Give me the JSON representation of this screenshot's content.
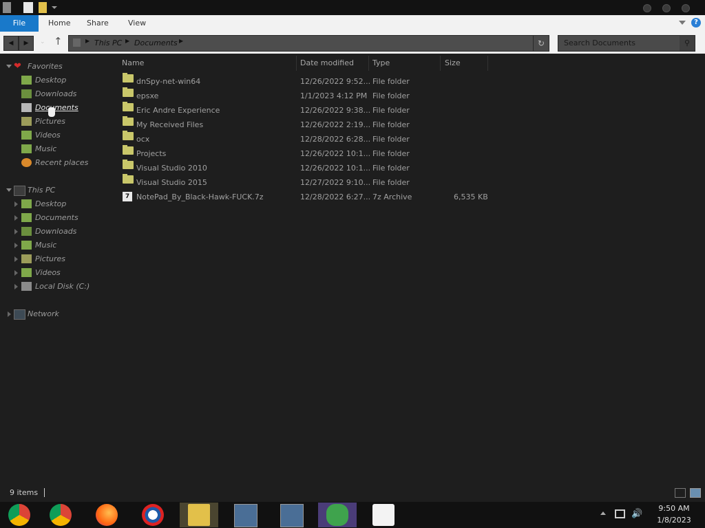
{
  "ribbon": {
    "tabs": [
      "File",
      "Home",
      "Share",
      "View"
    ]
  },
  "address": {
    "crumbs": [
      "This PC",
      "Documents"
    ],
    "search_placeholder": "Search Documents"
  },
  "sidebar": {
    "favorites_label": "Favorites",
    "favorites": [
      "Desktop",
      "Downloads",
      "Documents",
      "Pictures",
      "Videos",
      "Music",
      "Recent places"
    ],
    "thispc_label": "This PC",
    "thispc": [
      "Desktop",
      "Documents",
      "Downloads",
      "Music",
      "Pictures",
      "Videos",
      "Local Disk (C:)"
    ],
    "network_label": "Network"
  },
  "columns": {
    "name": "Name",
    "date": "Date modified",
    "type": "Type",
    "size": "Size"
  },
  "files": [
    {
      "name": "dnSpy-net-win64",
      "date": "12/26/2022 9:52...",
      "type": "File folder",
      "size": "",
      "icon": "folder-icon"
    },
    {
      "name": "epsxe",
      "date": "1/1/2023 4:12 PM",
      "type": "File folder",
      "size": "",
      "icon": "folder-icon"
    },
    {
      "name": "Eric Andre Experience",
      "date": "12/26/2022 9:38...",
      "type": "File folder",
      "size": "",
      "icon": "folder-icon"
    },
    {
      "name": "My Received Files",
      "date": "12/26/2022 2:19...",
      "type": "File folder",
      "size": "",
      "icon": "folder-icon"
    },
    {
      "name": "ocx",
      "date": "12/28/2022 6:28...",
      "type": "File folder",
      "size": "",
      "icon": "folder-icon"
    },
    {
      "name": "Projects",
      "date": "12/26/2022 10:1...",
      "type": "File folder",
      "size": "",
      "icon": "folder-icon"
    },
    {
      "name": "Visual Studio 2010",
      "date": "12/26/2022 10:1...",
      "type": "File folder",
      "size": "",
      "icon": "folder-icon"
    },
    {
      "name": "Visual Studio 2015",
      "date": "12/27/2022 9:10...",
      "type": "File folder",
      "size": "",
      "icon": "folder-icon"
    },
    {
      "name": "NotePad_By_Black-Hawk-FUCK.7z",
      "date": "12/28/2022 6:27...",
      "type": "7z Archive",
      "size": "6,535 KB",
      "icon": "7z-archive-icon"
    }
  ],
  "status": {
    "items": "9 items"
  },
  "taskbar": {
    "apps": [
      "chrome-icon",
      "chrome-icon",
      "firefox-icon",
      "obama-logo-icon",
      "file-explorer-icon",
      "installer-icon",
      "installer-icon",
      "messenger-icon",
      "java-icon"
    ],
    "time": "9:50 AM",
    "date": "1/8/2023"
  },
  "colors": {
    "accent": "#1979ca",
    "folder": "#c9c76a",
    "background": "#1e1e1e"
  }
}
